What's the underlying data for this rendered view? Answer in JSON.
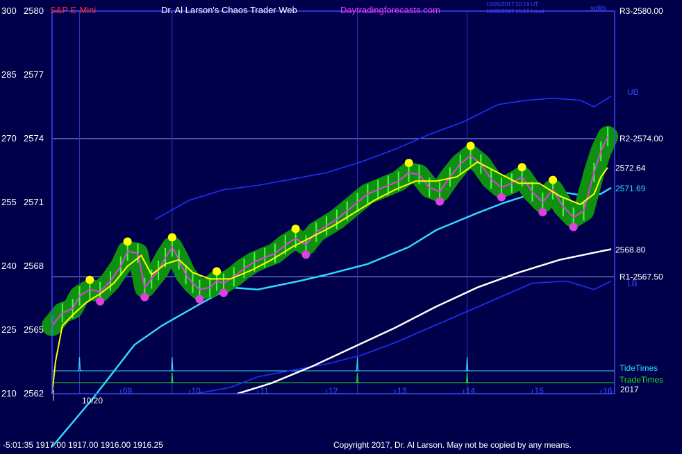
{
  "header": {
    "symbol": "S&P E-Mini",
    "title": "Dr. Al Larson's Chaos Trader Web",
    "site": "Daytradingforecasts.com",
    "timestamp_1": "10/20/2017 20:19 UT",
    "timestamp_2": "10/20/2017 15:19 Local",
    "corner_label": "splits"
  },
  "footer": {
    "readout": "-5:01:35  1917.00 1917.00 1916.00 1916.25",
    "copyright": "Copyright 2017, Dr. Al Larson. May not be copied by any means."
  },
  "colors": {
    "background": "#00004a",
    "frame": "#3a48ff",
    "price_yellow": "#ffff00",
    "highlight_green": "#109010",
    "band_blue": "#2030ff",
    "average_cyan": "#30d8ff",
    "long_average_white": "#ffffff",
    "magenta": "#e040e0",
    "tide": "#30d8ff",
    "trade": "#20e020"
  },
  "chart_data": {
    "type": "line",
    "date_label": "10/20",
    "year_label": "2017",
    "x_ticks": [
      "09",
      "10",
      "11",
      "12",
      "13",
      "14",
      "15",
      "16"
    ],
    "y_ticks": [
      {
        "osc": "300",
        "price": "2580"
      },
      {
        "osc": "285",
        "price": "2577"
      },
      {
        "osc": "270",
        "price": "2574"
      },
      {
        "osc": "255",
        "price": "2571"
      },
      {
        "osc": "240",
        "price": "2568"
      },
      {
        "osc": "225",
        "price": "2565"
      },
      {
        "osc": "210",
        "price": "2562"
      }
    ],
    "xlim": [
      8.0,
      16.2
    ],
    "ylim": [
      2562,
      2580
    ],
    "levels": [
      {
        "label": "R3-2580.00",
        "value": 2580.0
      },
      {
        "label": "R2-2574.00",
        "value": 2574.0
      },
      {
        "label": "R1-2567.50",
        "value": 2567.5
      }
    ],
    "end_labels": [
      {
        "label": "2572.64",
        "value": 2572.64,
        "color": "#ffffff"
      },
      {
        "label": "2571.69",
        "value": 2571.69,
        "color": "#30d8ff"
      },
      {
        "label": "2568.80",
        "value": 2568.8,
        "color": "#ffffff"
      }
    ],
    "band_labels": {
      "upper": "UB",
      "lower": "LB"
    },
    "timing_lines": [
      {
        "label": "TideTimes",
        "times": [
          8.4,
          9.75,
          12.45,
          14.05
        ]
      },
      {
        "label": "TradeTimes",
        "times": [
          9.75,
          12.45,
          14.05
        ]
      }
    ],
    "series": [
      {
        "role": "price",
        "x": [
          8.0,
          8.15,
          8.3,
          8.4,
          8.55,
          8.7,
          8.85,
          9.0,
          9.1,
          9.25,
          9.35,
          9.45,
          9.55,
          9.65,
          9.75,
          9.85,
          9.95,
          10.05,
          10.15,
          10.3,
          10.4,
          10.5,
          10.65,
          10.8,
          10.95,
          11.1,
          11.25,
          11.4,
          11.55,
          11.7,
          11.85,
          12.0,
          12.15,
          12.3,
          12.45,
          12.6,
          12.75,
          12.9,
          13.05,
          13.2,
          13.35,
          13.5,
          13.65,
          13.8,
          13.95,
          14.1,
          14.25,
          14.4,
          14.55,
          14.7,
          14.85,
          15.0,
          15.15,
          15.3,
          15.45,
          15.6,
          15.75,
          15.9,
          16.0,
          16.1
        ],
        "y": [
          2565.2,
          2565.8,
          2566.0,
          2566.6,
          2566.9,
          2566.8,
          2567.3,
          2568.0,
          2568.7,
          2568.6,
          2567.0,
          2567.4,
          2567.8,
          2568.4,
          2568.9,
          2568.3,
          2567.6,
          2567.2,
          2566.9,
          2567.0,
          2567.3,
          2567.2,
          2567.5,
          2567.9,
          2568.2,
          2568.4,
          2568.6,
          2569.0,
          2569.3,
          2569.0,
          2569.6,
          2569.9,
          2570.2,
          2570.6,
          2571.0,
          2571.4,
          2571.6,
          2571.8,
          2572.0,
          2572.4,
          2572.3,
          2571.7,
          2571.5,
          2572.2,
          2572.8,
          2573.2,
          2572.8,
          2572.1,
          2571.7,
          2571.9,
          2572.2,
          2571.5,
          2571.0,
          2571.6,
          2570.8,
          2570.3,
          2570.6,
          2572.4,
          2573.4,
          2574.1
        ]
      },
      {
        "role": "average",
        "x": [
          8.0,
          8.6,
          9.2,
          9.6,
          10.2,
          10.6,
          11.0,
          11.6,
          12.0,
          12.6,
          13.2,
          13.6,
          14.2,
          14.6,
          15.0,
          15.4,
          15.8,
          16.0,
          16.15
        ],
        "y": [
          2559.5,
          2561.8,
          2564.3,
          2565.2,
          2566.3,
          2567.0,
          2566.9,
          2567.3,
          2567.6,
          2568.1,
          2568.9,
          2569.7,
          2570.5,
          2571.0,
          2571.4,
          2571.5,
          2571.3,
          2571.4,
          2571.69
        ]
      },
      {
        "role": "long average",
        "x": [
          10.7,
          11.2,
          11.8,
          12.4,
          13.0,
          13.6,
          14.2,
          14.8,
          15.4,
          16.0,
          16.15
        ],
        "y": [
          2562.0,
          2562.5,
          2563.3,
          2564.2,
          2565.1,
          2566.1,
          2567.0,
          2567.7,
          2568.3,
          2568.7,
          2568.8
        ]
      },
      {
        "role": "upper band",
        "x": [
          9.5,
          10.0,
          10.5,
          11.0,
          11.5,
          12.0,
          12.5,
          13.0,
          13.5,
          14.0,
          14.5,
          14.9,
          15.3,
          15.7,
          15.9,
          16.15
        ],
        "y": [
          2570.2,
          2571.1,
          2571.6,
          2571.8,
          2572.1,
          2572.4,
          2572.9,
          2573.5,
          2574.2,
          2574.8,
          2575.6,
          2575.8,
          2575.9,
          2575.8,
          2575.5,
          2576.0
        ]
      },
      {
        "role": "lower band",
        "x": [
          10.1,
          10.6,
          11.0,
          11.5,
          12.0,
          12.5,
          13.0,
          13.5,
          14.0,
          14.5,
          15.0,
          15.5,
          15.9,
          16.15
        ],
        "y": [
          2562.0,
          2562.3,
          2562.8,
          2563.1,
          2563.4,
          2563.8,
          2564.4,
          2565.1,
          2565.8,
          2566.5,
          2567.2,
          2567.3,
          2566.9,
          2567.3
        ]
      },
      {
        "role": "fast line",
        "x": [
          8.0,
          8.05,
          8.15,
          8.3,
          8.5,
          8.7,
          8.9,
          9.1,
          9.3,
          9.45,
          9.65,
          9.85,
          10.05,
          10.3,
          10.6,
          10.9,
          11.2,
          11.5,
          11.8,
          12.1,
          12.4,
          12.7,
          13.0,
          13.3,
          13.6,
          13.9,
          14.2,
          14.5,
          14.8,
          15.1,
          15.4,
          15.7,
          15.9,
          16.0,
          16.1
        ],
        "y": [
          2562.0,
          2563.5,
          2565.2,
          2565.7,
          2566.3,
          2566.7,
          2567.2,
          2568.0,
          2568.5,
          2567.6,
          2568.1,
          2568.3,
          2567.7,
          2567.4,
          2567.4,
          2567.8,
          2568.3,
          2568.9,
          2569.4,
          2569.9,
          2570.5,
          2571.1,
          2571.6,
          2572.0,
          2572.0,
          2572.2,
          2572.9,
          2572.4,
          2571.9,
          2571.9,
          2571.3,
          2570.9,
          2571.4,
          2572.2,
          2572.64
        ]
      }
    ]
  }
}
